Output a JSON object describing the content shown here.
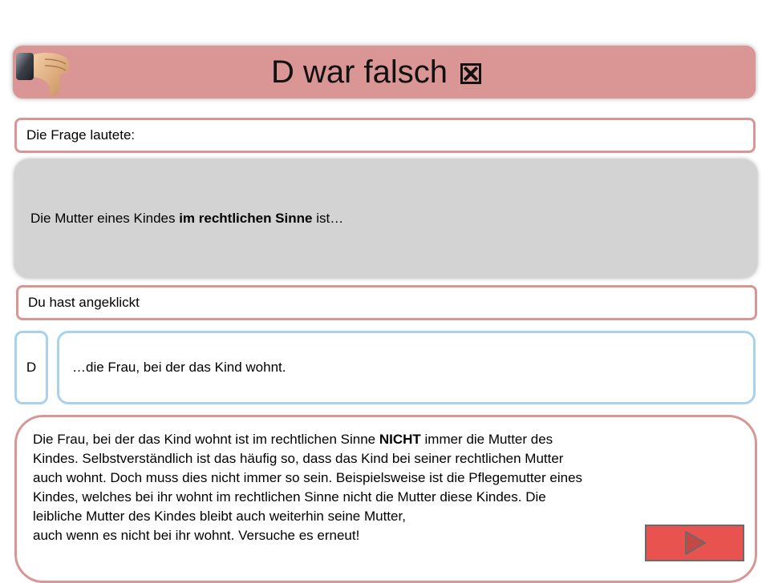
{
  "banner": {
    "title": "D war falsch",
    "status_icon": "x-box-icon",
    "color": "#d99695"
  },
  "question_label": "Die Frage lautete:",
  "question": {
    "before": "Die Mutter eines Kindes ",
    "emphasis": "im rechtlichen Sinne",
    "after": " ist…"
  },
  "clicked_label": "Du hast angeklickt",
  "answer": {
    "letter": "D",
    "text": "…die Frau, bei der das Kind wohnt."
  },
  "explanation": {
    "line1_before": "Die Frau, bei der das Kind wohnt ist im rechtlichen Sinne ",
    "line1_bold": "NICHT",
    "line1_after": " immer die Mutter des",
    "line2": "Kindes. Selbstverständlich ist das häufig so, dass das Kind bei seiner rechtlichen Mutter",
    "line3": "auch wohnt. Doch muss dies nicht immer so sein. Beispielsweise ist die Pflegemutter eines",
    "line4": "Kindes, welches bei ihr wohnt im rechtlichen Sinne nicht die Mutter diese Kindes. Die",
    "line5": "leibliche Mutter des Kindes bleibt auch weiterhin seine Mutter,",
    "line6": "auch wenn es nicht bei ihr wohnt. Versuche es erneut!"
  },
  "next_button": {
    "icon": "play-triangle-icon",
    "color": "#e8534f"
  }
}
